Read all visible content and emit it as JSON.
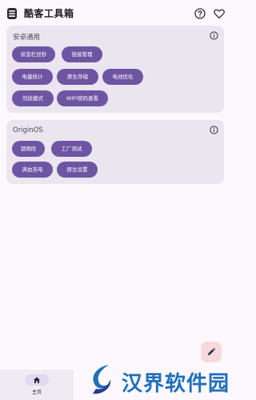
{
  "app": {
    "title": "酷客工具箱"
  },
  "header": {
    "help_icon": "help-circle-icon",
    "favorite_icon": "heart-outline-icon"
  },
  "sections": [
    {
      "title": "安卓通用",
      "chips": [
        "状态栏显秒",
        "链接管理",
        "电量统计",
        "原生存储",
        "电池优化",
        "勿扰模式",
        "WIFI密码查看"
      ]
    },
    {
      "title": "OriginOS",
      "chips": [
        "锁频段",
        "工厂测试",
        "满血充电",
        "原生设置"
      ]
    }
  ],
  "fab": {
    "icon": "edit-pencil-icon"
  },
  "bottom_nav": {
    "home_label": "主页",
    "home_icon": "home-icon"
  },
  "watermark": {
    "text": "汉界软件园"
  },
  "colors": {
    "chip": "#6e55a3",
    "card": "#ebe5ef",
    "background": "#fcf8fd",
    "fab": "#f6d9dd",
    "watermark": "#1f6fb9"
  }
}
